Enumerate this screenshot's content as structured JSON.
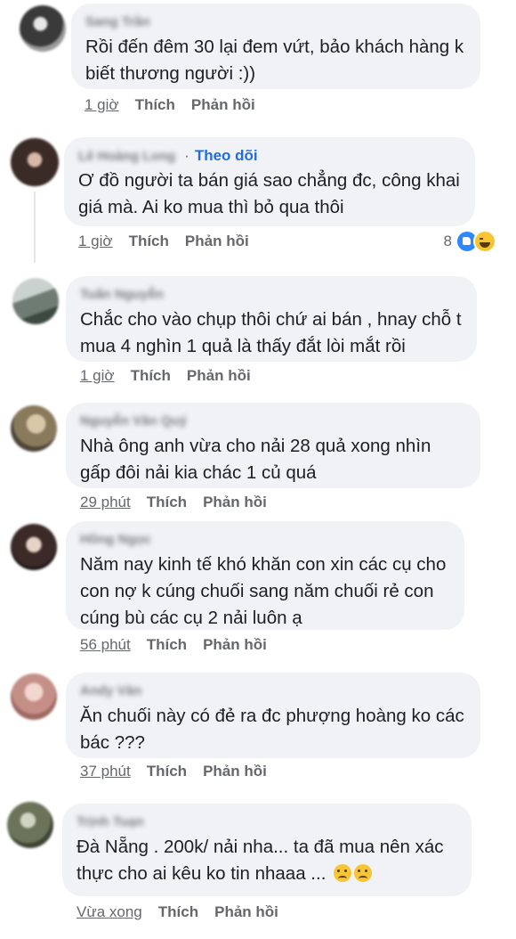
{
  "comments": [
    {
      "author": "Sang Trần",
      "text": "Rồi đến đêm 30 lại đem vứt, bảo khách hàng k biết thương người :))",
      "time": "1 giờ",
      "like": "Thích",
      "reply": "Phản hồi",
      "avatar_color": "#4a4a4a"
    },
    {
      "author": "Lê Hoàng Long",
      "follow": "Theo dõi",
      "follow_dot": "·",
      "text": "Ơ đồ người ta bán giá sao chẳng đc, công khai giá mà. Ai ko mua thì bỏ qua thôi",
      "time": "1 giờ",
      "like": "Thích",
      "reply": "Phản hồi",
      "reaction_count": "8",
      "reaction_icons": [
        "like-icon",
        "haha-icon"
      ],
      "avatar_color": "#3b2b26"
    },
    {
      "author": "Tuấn Nguyễn",
      "text": "Chắc cho vào chụp thôi chứ ai bán , hnay chỗ t mua 4 nghìn 1 quả là thấy đắt lòi mắt rồi",
      "time": "1 giờ",
      "like": "Thích",
      "reply": "Phản hồi",
      "avatar_color": "#7d8a7a"
    },
    {
      "author": "Nguyễn Văn Quý",
      "text": "Nhà ông anh vừa cho nải 28 quả xong nhìn gấp đôi nải kia chác 1 củ quá",
      "time": "29 phút",
      "like": "Thích",
      "reply": "Phản hồi",
      "avatar_color": "#8a7a5c"
    },
    {
      "author": "Hồng Ngọc",
      "text": "Năm nay kinh tế khó khăn con xin các cụ cho con nợ k cúng chuối sang năm chuối rẻ con cúng bù các cụ 2 nải luôn ạ",
      "time": "56 phút",
      "like": "Thích",
      "reply": "Phản hồi",
      "avatar_color": "#3c2a28"
    },
    {
      "author": "Andy Văn",
      "text": "Ăn chuối này có đẻ ra đc phượng hoàng ko các bác ???",
      "time": "37 phút",
      "like": "Thích",
      "reply": "Phản hồi",
      "avatar_color": "#b4877f"
    },
    {
      "author": "Trịnh Tuạn",
      "text": "Đà Nẵng . 200k/ nải nha... ta đã mua nên xác thực cho ai kêu ko tin nhaaa ...",
      "emojis": [
        "crying-emoji",
        "crying-emoji"
      ],
      "time": "Vừa xong",
      "like": "Thích",
      "reply": "Phản hồi",
      "avatar_color": "#6b735a"
    }
  ],
  "colors": {
    "bubble": "#f0f2f5",
    "text": "#1c1e21",
    "meta": "#65676b",
    "link": "#216fdb"
  }
}
